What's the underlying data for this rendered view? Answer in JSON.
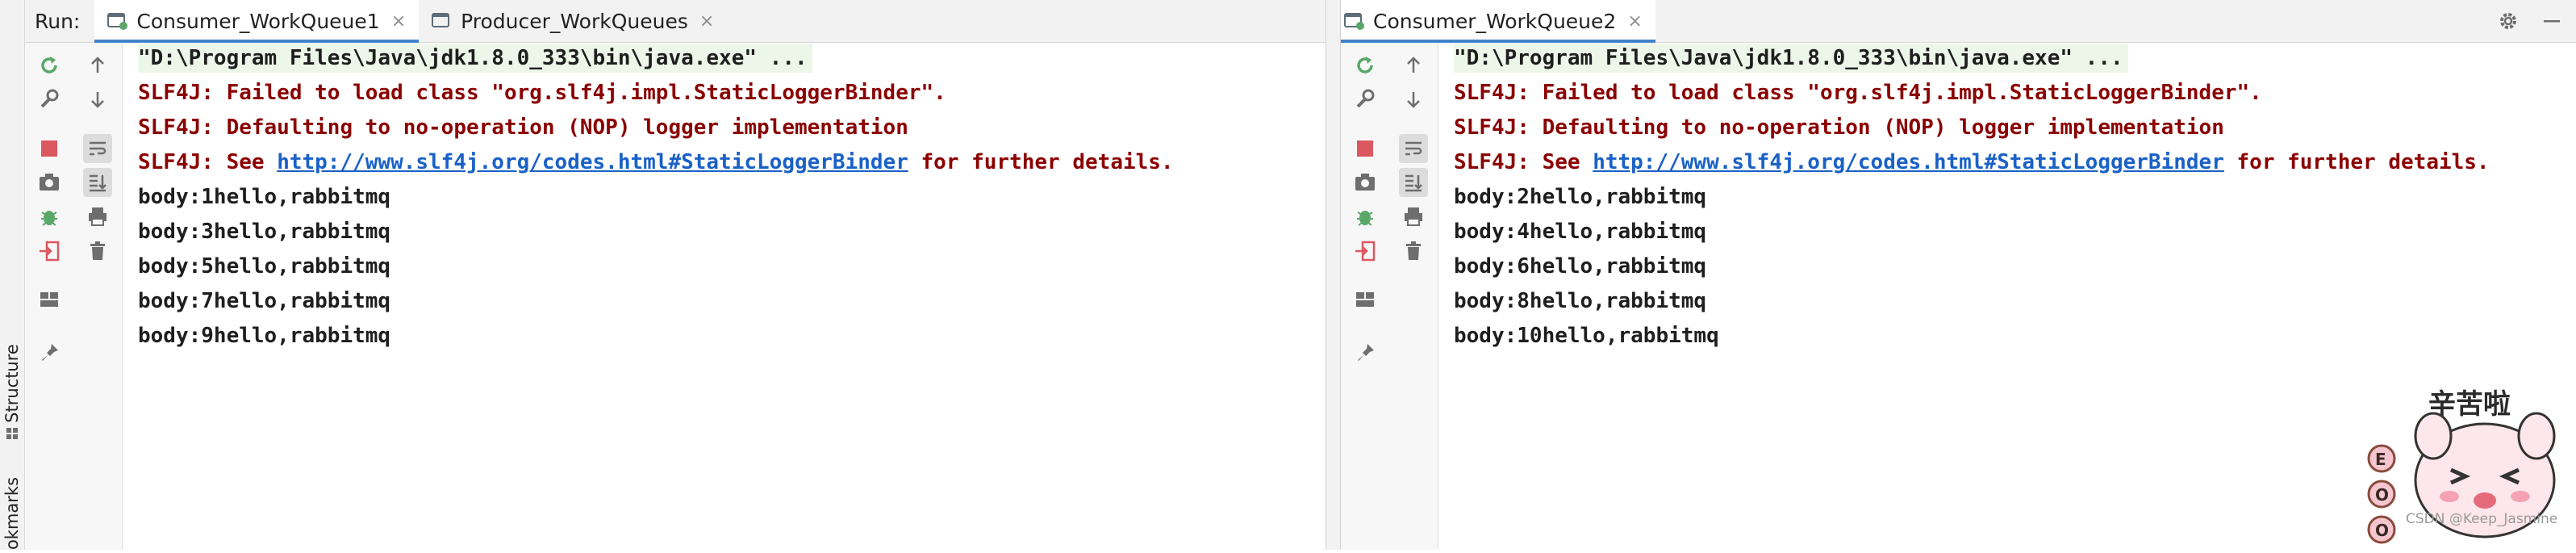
{
  "sidebar": {
    "structure_label": "Structure",
    "bookmarks_label": "okmarks"
  },
  "left_panel": {
    "run_label": "Run:",
    "tabs": [
      {
        "label": "Consumer_WorkQueue1",
        "close": "×"
      },
      {
        "label": "Producer_WorkQueues",
        "close": "×"
      }
    ],
    "console": {
      "cmd": "\"D:\\Program Files\\Java\\jdk1.8.0_333\\bin\\java.exe\" ...",
      "slf_fail": "SLF4J: Failed to load class \"org.slf4j.impl.StaticLoggerBinder\".",
      "slf_default": "SLF4J: Defaulting to no-operation (NOP) logger implementation",
      "slf_see_prefix": "SLF4J: See ",
      "slf_link": "http://www.slf4j.org/codes.html#StaticLoggerBinder",
      "slf_see_suffix": " for further details.",
      "outputs": [
        "body:1hello,rabbitmq",
        "body:3hello,rabbitmq",
        "body:5hello,rabbitmq",
        "body:7hello,rabbitmq",
        "body:9hello,rabbitmq"
      ]
    }
  },
  "right_panel": {
    "tabs": [
      {
        "label": "Consumer_WorkQueue2",
        "close": "×"
      }
    ],
    "console": {
      "cmd": "\"D:\\Program Files\\Java\\jdk1.8.0_333\\bin\\java.exe\" ...",
      "slf_fail": "SLF4J: Failed to load class \"org.slf4j.impl.StaticLoggerBinder\".",
      "slf_default": "SLF4J: Defaulting to no-operation (NOP) logger implementation",
      "slf_see_prefix": "SLF4J: See ",
      "slf_link": "http://www.slf4j.org/codes.html#StaticLoggerBinder",
      "slf_see_suffix": " for further details.",
      "outputs": [
        "body:2hello,rabbitmq",
        "body:4hello,rabbitmq",
        "body:6hello,rabbitmq",
        "body:8hello,rabbitmq",
        "body:10hello,rabbitmq"
      ]
    }
  },
  "sticker": {
    "title": "辛苦啦",
    "side_letters": [
      "E",
      "O",
      "O"
    ],
    "watermark": "CSDN @Keep_Jasmine"
  },
  "colors": {
    "rerun": "#59a869",
    "stop": "#db5860",
    "link": "#1a61c7",
    "error_text": "#8b0000",
    "tab_underline": "#4083c9"
  },
  "icons": {
    "rerun": "rerun-icon",
    "settings": "wrench-icon",
    "stop": "stop-icon",
    "screenshot": "camera-icon",
    "debug": "bug-icon",
    "exit": "exit-icon",
    "layout": "layout-icon",
    "pin": "pin-icon",
    "up": "arrow-up-icon",
    "down": "arrow-down-icon",
    "wrap": "soft-wrap-icon",
    "scroll": "scroll-to-end-icon",
    "print": "print-icon",
    "trash": "trash-icon",
    "gear": "gear-icon",
    "minimize": "minimize-icon"
  }
}
